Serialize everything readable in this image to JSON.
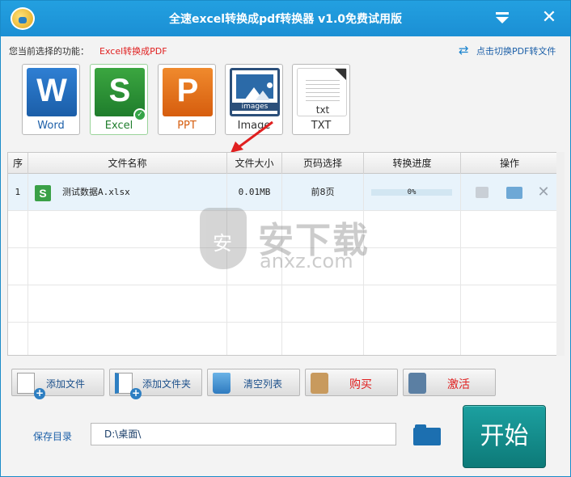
{
  "window": {
    "title": "全速excel转换成pdf转换器 v1.0免费试用版"
  },
  "function_select": {
    "label": "您当前选择的功能：",
    "current": "Excel转换成PDF",
    "switch_link": "点击切换PDF转文件"
  },
  "formats": [
    {
      "label": "Word",
      "icon": "word-icon",
      "letter": "W"
    },
    {
      "label": "Excel",
      "icon": "excel-icon",
      "letter": "S",
      "selected": true
    },
    {
      "label": "PPT",
      "icon": "ppt-icon",
      "letter": "P"
    },
    {
      "label": "Image",
      "icon": "image-icon",
      "icon_text": "images"
    },
    {
      "label": "TXT",
      "icon": "txt-icon",
      "icon_text": "txt"
    }
  ],
  "table": {
    "columns": [
      "序",
      "文件名称",
      "文件大小",
      "页码选择",
      "转换进度",
      "操作"
    ],
    "rows": [
      {
        "index": "1",
        "name": "测试数据A.xlsx",
        "size": "0.01MB",
        "pages": "前8页",
        "progress": "0%",
        "progress_value": 0
      }
    ]
  },
  "watermark": {
    "cn": "安下载",
    "en": "anxz.com"
  },
  "buttons": {
    "add_file": "添加文件",
    "add_folder": "添加文件夹",
    "clear_list": "清空列表",
    "buy": "购买",
    "activate": "激活",
    "start": "开始"
  },
  "save": {
    "label": "保存目录",
    "path": "D:\\桌面\\"
  },
  "colors": {
    "titlebar": "#1b8fd4",
    "accent_red": "#e02020",
    "start_button": "#0d7a78",
    "link_blue": "#1b5fa8"
  }
}
